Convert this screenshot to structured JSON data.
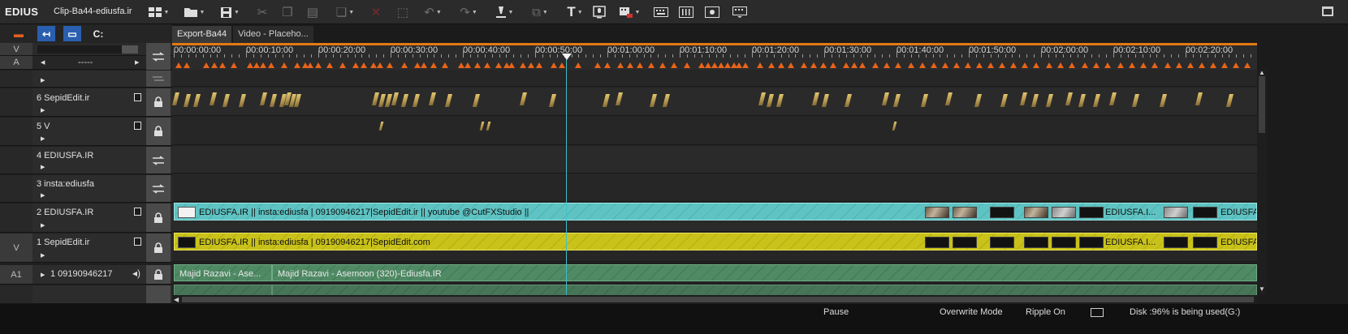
{
  "app": {
    "name": "EDIUS",
    "project": "Clip-Ba44-ediusfa.ir"
  },
  "toolbar": {
    "icons": [
      "new-sequence-icon",
      "open-folder-icon",
      "save-icon",
      "cut-icon",
      "copy-icon",
      "paste-icon",
      "paste-insert-icon",
      "delete-icon",
      "ripple-delete-icon",
      "undo-icon",
      "redo-icon",
      "marker-icon",
      "group-icon",
      "title-icon",
      "voice-over-icon",
      "render-icon",
      "keyboard-icon",
      "audio-mixer-icon",
      "settings-icon",
      "keyboard-shortcut-icon"
    ]
  },
  "mode_buttons": [
    "trim-mode",
    "insert-mode",
    "sync-mode",
    "snap-mode"
  ],
  "tabs": [
    {
      "label": "Export-Ba44"
    },
    {
      "label": "Video - Placeho..."
    }
  ],
  "header_labels": {
    "v": "V",
    "a": "A",
    "dashes": "-----"
  },
  "ruler": {
    "timecodes": [
      "00:00:00:00",
      "00:00:10:00",
      "00:00:20:00",
      "00:00:30:00",
      "00:00:40:00",
      "00:00:50:00",
      "00:01:00:00",
      "00:01:10:00",
      "00:01:20:00",
      "00:01:30:00",
      "00:01:40:00",
      "00:01:50:00",
      "00:02:00:00",
      "00:02:10:00",
      "00:02:20:00"
    ]
  },
  "tracks": [
    {
      "name": "6 SepidEdit.ir",
      "side": "",
      "kind": "video"
    },
    {
      "name": "5 V",
      "side": "",
      "kind": "video"
    },
    {
      "name": "4 EDIUSFA.IR",
      "side": "",
      "kind": "title"
    },
    {
      "name": "3 insta:ediusfa",
      "side": "",
      "kind": "title"
    },
    {
      "name": "2 EDIUSFA.IR",
      "side": "",
      "kind": "video"
    },
    {
      "name": "1 SepidEdit.ir",
      "side": "V",
      "kind": "video"
    },
    {
      "name": "1 09190946217",
      "side": "A1",
      "kind": "audio"
    }
  ],
  "clips": {
    "track2": "EDIUSFA.IR || insta:ediusfa |  09190946217|SepidEdit.ir  || youtube @CutFXStudio ||",
    "track2_end_a": "EDIUSFA.I...",
    "track2_end_b": "EDIUSFA.I...",
    "track1": "EDIUSFA.IR || insta:ediusfa |  09190946217|SepidEdit.com",
    "track1_end_a": "EDIUSFA.I...",
    "track1_end_b": "EDIUSFA.I...",
    "audio_a": "Majid Razavi - Ase...",
    "audio_b": "Majid Razavi - Asemoon (320)-Ediusfa.IR"
  },
  "status": {
    "pause": "Pause",
    "mode": "Overwrite Mode",
    "ripple": "Ripple On",
    "disk": "Disk :96% is being used(G:)"
  },
  "colors": {
    "accent": "#e07a14",
    "video_clip": "#5fc3c3",
    "main_clip": "#c9c21a",
    "audio_clip": "#4f8a64",
    "playhead": "#3fbfc8"
  }
}
